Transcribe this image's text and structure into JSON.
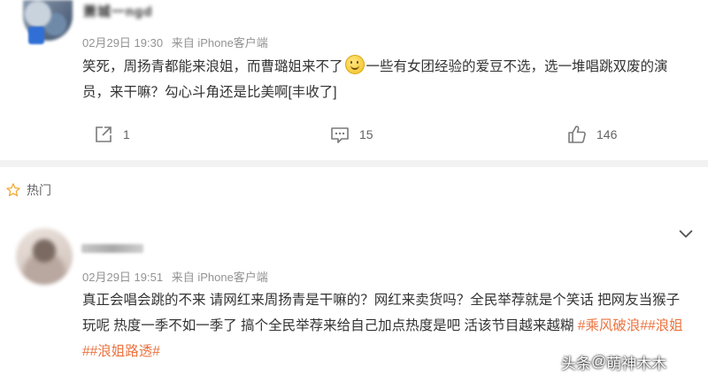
{
  "post1": {
    "username": "萧城一ngd",
    "date": "02月29日 19:30",
    "source": "来自 iPhone客户端",
    "text_before_emoji": "笑死，周扬青都能来浪姐，而曹璐姐来不了",
    "text_after_emoji": "一些有女团经验的爱豆不选，选一堆唱跳双废的演员，来干嘛？勾心斗角还是比美啊[丰收了]",
    "emoji_icon": "smile-emoji-icon",
    "share_count": "1",
    "comment_count": "15",
    "like_count": "146"
  },
  "hot": {
    "label": "热门",
    "icon": "star-icon"
  },
  "post2": {
    "date": "02月29日 19:51",
    "source": "来自 iPhone客户端",
    "text": "真正会唱会跳的不来 请网红来周扬青是干嘛的？网红来卖货吗？全民举荐就是个笑话 把网友当猴子玩呢 热度一季不如一季了 搞个全民举荐来给自己加点热度是吧 活该节目越来越糊 ",
    "hashtags": [
      "#乘风破浪#",
      "#浪姐#",
      "#浪姐路透#"
    ]
  },
  "watermark": {
    "prefix": "头条",
    "at": "@",
    "name": "萌神木木"
  },
  "colors": {
    "hashtag": "#eb7340",
    "meta": "#939393",
    "text": "#333333"
  }
}
